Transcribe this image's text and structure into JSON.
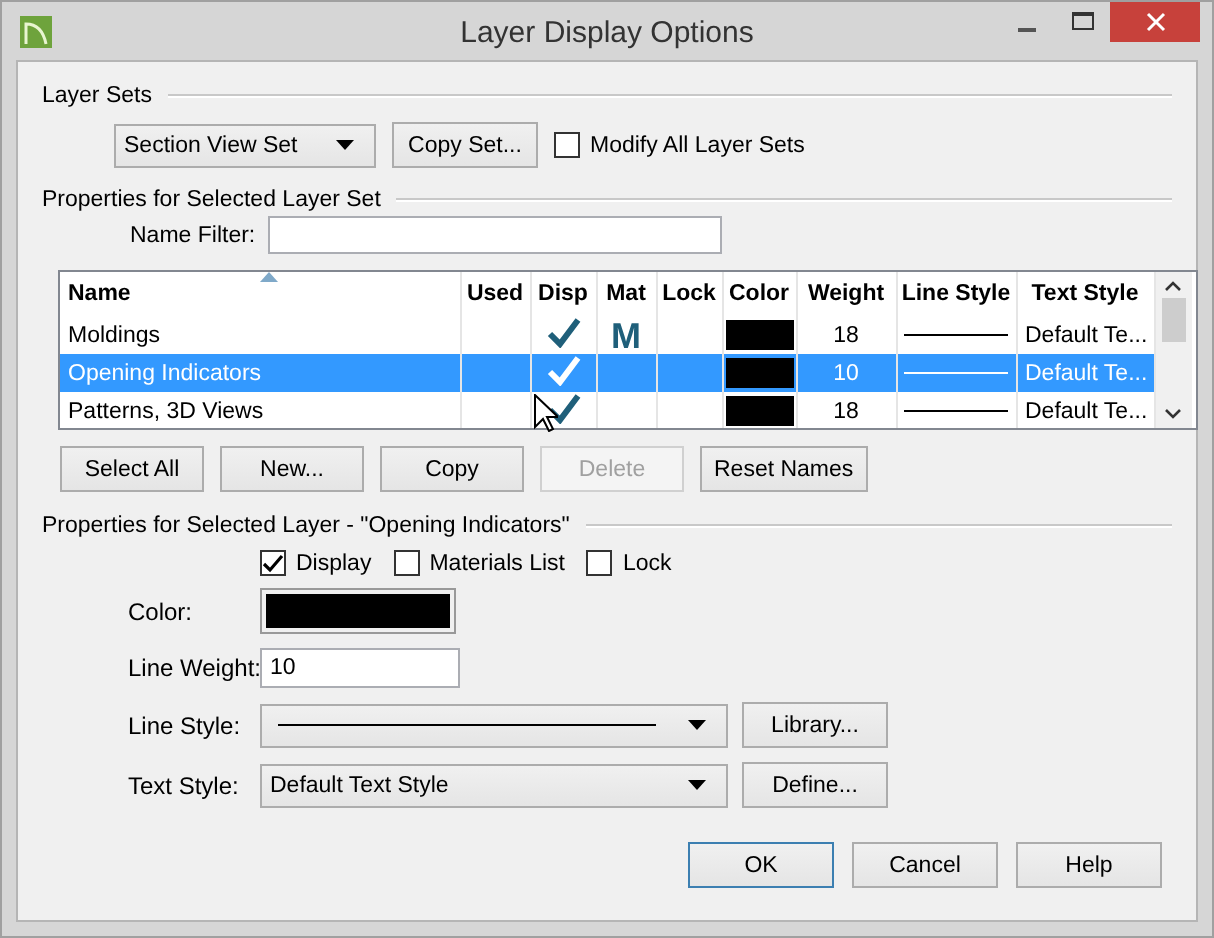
{
  "window": {
    "title": "Layer Display Options"
  },
  "layer_sets": {
    "heading": "Layer Sets",
    "set_dropdown": "Section View Set",
    "copy_button": "Copy Set...",
    "modify_all": {
      "label": "Modify All Layer Sets",
      "checked": false
    }
  },
  "set_properties": {
    "heading": "Properties for Selected Layer Set",
    "name_filter_label": "Name Filter:"
  },
  "table": {
    "columns": [
      "Name",
      "Used",
      "Disp",
      "Mat",
      "Lock",
      "Color",
      "Weight",
      "Line Style",
      "Text Style"
    ],
    "mat_mark": "M",
    "rows": [
      {
        "name": "Moldings",
        "disp": true,
        "mat": true,
        "lock": false,
        "color": "#000000",
        "weight": "18",
        "text_style": "Default Te...",
        "selected": false
      },
      {
        "name": "Opening Indicators",
        "disp": true,
        "mat": false,
        "lock": false,
        "color": "#000000",
        "weight": "10",
        "text_style": "Default Te...",
        "selected": true
      },
      {
        "name": "Patterns, 3D Views",
        "disp": true,
        "mat": false,
        "lock": false,
        "color": "#000000",
        "weight": "18",
        "text_style": "Default Te...",
        "selected": false
      }
    ]
  },
  "table_buttons": [
    {
      "label": "Select All",
      "disabled": false
    },
    {
      "label": "New...",
      "disabled": false
    },
    {
      "label": "Copy",
      "disabled": false
    },
    {
      "label": "Delete",
      "disabled": true
    },
    {
      "label": "Reset Names",
      "disabled": false
    }
  ],
  "layer_properties": {
    "heading": "Properties for Selected Layer - \"Opening Indicators\"",
    "checkboxes": [
      {
        "label": "Display",
        "checked": true
      },
      {
        "label": "Materials List",
        "checked": false
      },
      {
        "label": "Lock",
        "checked": false
      }
    ],
    "color_label": "Color:",
    "color": "#000000",
    "line_weight_label": "Line Weight:",
    "line_weight": "10",
    "line_style_label": "Line Style:",
    "library_button": "Library...",
    "text_style_label": "Text Style:",
    "text_style": "Default Text Style",
    "define_button": "Define..."
  },
  "buttons": [
    {
      "label": "OK",
      "default": true
    },
    {
      "label": "Cancel",
      "default": false
    },
    {
      "label": "Help",
      "default": false
    }
  ]
}
